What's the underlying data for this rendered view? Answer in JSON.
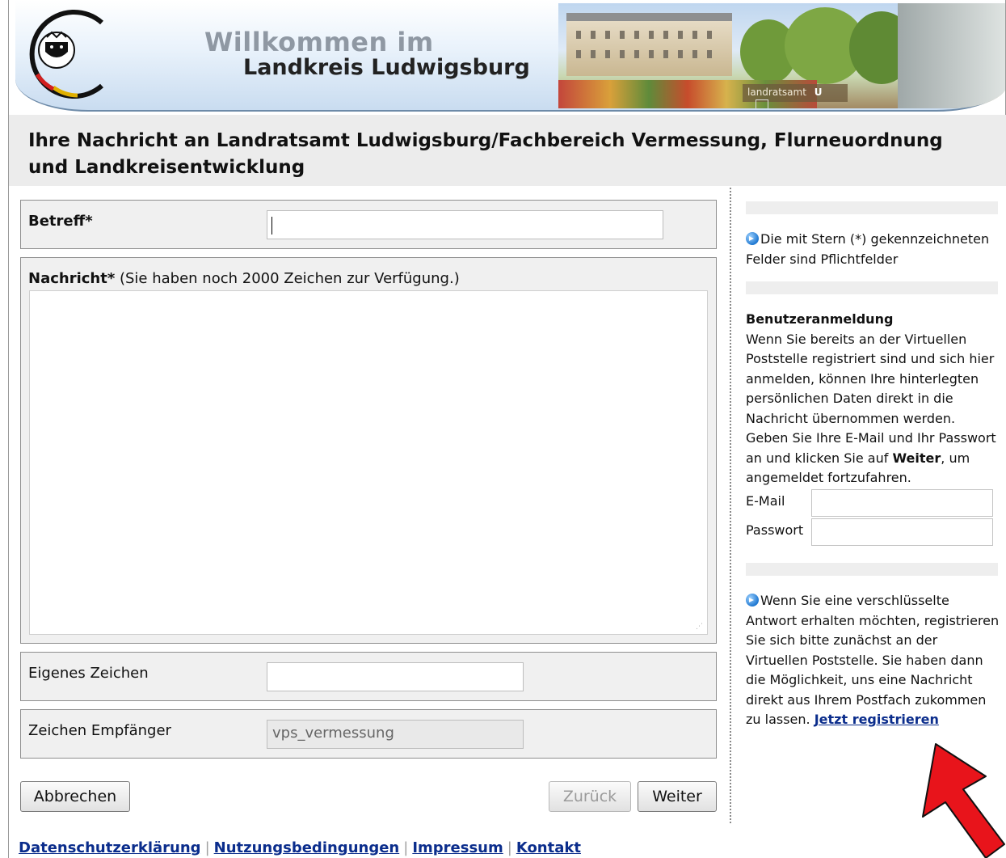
{
  "header": {
    "title_line1": "Willkommen im",
    "title_line2": "Landkreis Ludwigsburg",
    "photo_sign_text": "landratsamt",
    "photo_sign_badge": "U"
  },
  "page": {
    "heading": "Ihre Nachricht an Landratsamt Ludwigsburg/Fachbereich Vermessung, Flurneuordnung und Landkreisentwicklung"
  },
  "form": {
    "betreff_label": "Betreff*",
    "betreff_value": "",
    "nachricht_label": "Nachricht*",
    "nachricht_hint": "(Sie haben noch 2000 Zeichen zur Verfügung.)",
    "nachricht_value": "",
    "eigenes_zeichen_label": "Eigenes Zeichen",
    "eigenes_zeichen_value": "",
    "zeichen_empfaenger_label": "Zeichen Empfänger",
    "zeichen_empfaenger_value": "vps_vermessung"
  },
  "buttons": {
    "abbrechen": "Abbrechen",
    "zurueck": "Zurück",
    "weiter": "Weiter"
  },
  "sidebar": {
    "required_note": "Die mit Stern (*) gekennzeichneten Felder sind Pflichtfelder",
    "login_heading": "Benutzeranmeldung",
    "login_text_before": "Wenn Sie bereits an der Virtuellen Poststelle registriert sind und sich hier anmelden, können Ihre hinterlegten persönlichen Daten direkt in die Nachricht übernommen werden. Geben Sie Ihre E-Mail und Ihr Passwort an und klicken Sie auf ",
    "login_text_bold": "Weiter",
    "login_text_after": ", um angemeldet fortzufahren.",
    "email_label": "E-Mail",
    "email_value": "",
    "password_label": "Passwort",
    "password_value": "",
    "encrypted_note": "Wenn Sie eine verschlüsselte Antwort erhalten möchten, registrieren Sie sich bitte zunächst an der Virtuellen Poststelle. Sie haben dann die Möglichkeit, uns eine Nachricht direkt aus Ihrem Postfach zukommen zu lassen. ",
    "register_link": "Jetzt registrieren"
  },
  "footer": {
    "links": [
      "Datenschutzerklärung",
      "Nutzungsbedingungen",
      "Impressum",
      "Kontakt"
    ]
  },
  "colors": {
    "link": "#0b2d8c",
    "annotation_arrow": "#e8141b",
    "heading_bar": "#ececec"
  },
  "icons": {
    "info": "info-arrow-icon",
    "logo": "coat-of-arms-logo",
    "annotation": "red-arrow-icon"
  }
}
